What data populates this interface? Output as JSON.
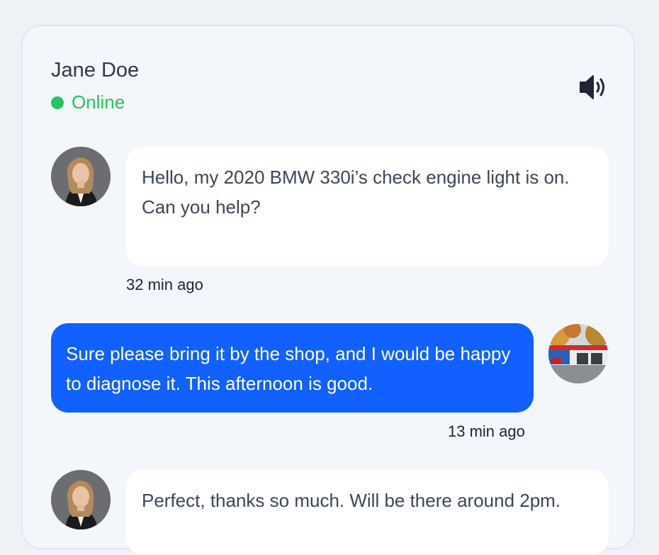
{
  "contact": {
    "name": "Jane Doe",
    "status": "Online",
    "status_color": "#22c55e"
  },
  "header": {
    "sound_icon": "speaker-volume-icon"
  },
  "colors": {
    "accent": "#1260ff",
    "incoming_bubble": "#ffffff",
    "background": "#f3f6fa"
  },
  "messages": [
    {
      "direction": "incoming",
      "text": "Hello, my 2020 BMW 330i’s check engine light is on. Can you help?",
      "time": "32 min ago"
    },
    {
      "direction": "outgoing",
      "text": "Sure please bring it by the shop, and I would be happy to diagnose it. This afternoon is good.",
      "time": "13 min ago"
    },
    {
      "direction": "incoming",
      "text": "Perfect, thanks so much. Will be there around 2pm.",
      "time": ""
    }
  ]
}
